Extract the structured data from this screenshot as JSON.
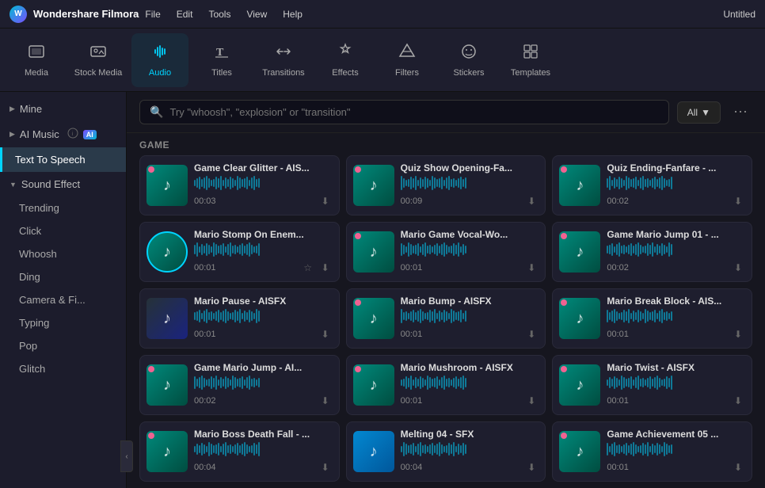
{
  "titleBar": {
    "appName": "Wondershare Filmora",
    "menuItems": [
      "File",
      "Edit",
      "Tools",
      "View",
      "Help"
    ],
    "windowTitle": "Untitled"
  },
  "toolbar": {
    "items": [
      {
        "id": "media",
        "label": "Media",
        "icon": "🎬"
      },
      {
        "id": "stock-media",
        "label": "Stock Media",
        "icon": "📷"
      },
      {
        "id": "audio",
        "label": "Audio",
        "icon": "🎵",
        "active": true
      },
      {
        "id": "titles",
        "label": "Titles",
        "icon": "T"
      },
      {
        "id": "transitions",
        "label": "Transitions",
        "icon": "⇄"
      },
      {
        "id": "effects",
        "label": "Effects",
        "icon": "✦"
      },
      {
        "id": "filters",
        "label": "Filters",
        "icon": "⬡"
      },
      {
        "id": "stickers",
        "label": "Stickers",
        "icon": "😊"
      },
      {
        "id": "templates",
        "label": "Templates",
        "icon": "▦"
      }
    ]
  },
  "sidebar": {
    "mineLabel": "Mine",
    "aiMusicLabel": "AI Music",
    "textToSpeechLabel": "Text To Speech",
    "soundEffectLabel": "Sound Effect",
    "soundEffectItems": [
      {
        "id": "trending",
        "label": "Trending"
      },
      {
        "id": "click",
        "label": "Click"
      },
      {
        "id": "whoosh",
        "label": "Whoosh"
      },
      {
        "id": "ding",
        "label": "Ding"
      },
      {
        "id": "camera",
        "label": "Camera & Fi..."
      },
      {
        "id": "typing",
        "label": "Typing"
      },
      {
        "id": "pop",
        "label": "Pop"
      },
      {
        "id": "glitch",
        "label": "Glitch"
      }
    ]
  },
  "search": {
    "placeholder": "Try \"whoosh\", \"explosion\" or \"transition\"",
    "filterLabel": "All"
  },
  "sectionLabel": "GAME",
  "sounds": [
    [
      {
        "title": "Game Clear Glitter - AIS...",
        "duration": "00:03",
        "favored": true,
        "thumbType": "teal"
      },
      {
        "title": "Quiz Show Opening-Fa...",
        "duration": "00:09",
        "favored": true,
        "thumbType": "teal"
      },
      {
        "title": "Quiz Ending-Fanfare - ...",
        "duration": "00:02",
        "favored": true,
        "thumbType": "teal"
      }
    ],
    [
      {
        "title": "Mario Stomp On Enem...",
        "duration": "00:01",
        "favored": false,
        "thumbType": "spinning",
        "hasMore": true
      },
      {
        "title": "Mario Game Vocal-Wo...",
        "duration": "00:01",
        "favored": true,
        "thumbType": "teal"
      },
      {
        "title": "Game Mario Jump 01 - ...",
        "duration": "00:02",
        "favored": true,
        "thumbType": "teal"
      }
    ],
    [
      {
        "title": "Mario Pause - AISFX",
        "duration": "00:01",
        "favored": false,
        "thumbType": "dark"
      },
      {
        "title": "Mario Bump - AISFX",
        "duration": "00:01",
        "favored": true,
        "thumbType": "teal"
      },
      {
        "title": "Mario Break Block - AIS...",
        "duration": "00:01",
        "favored": true,
        "thumbType": "teal"
      }
    ],
    [
      {
        "title": "Game Mario Jump - AI...",
        "duration": "00:02",
        "favored": true,
        "thumbType": "teal"
      },
      {
        "title": "Mario Mushroom - AISFX",
        "duration": "00:01",
        "favored": true,
        "thumbType": "teal"
      },
      {
        "title": "Mario Twist - AISFX",
        "duration": "00:01",
        "favored": true,
        "thumbType": "teal"
      }
    ],
    [
      {
        "title": "Mario Boss Death Fall - ...",
        "duration": "00:04",
        "favored": true,
        "thumbType": "teal"
      },
      {
        "title": "Melting 04 - SFX",
        "duration": "00:04",
        "favored": false,
        "thumbType": "blue"
      },
      {
        "title": "Game Achievement 05 ...",
        "duration": "00:01",
        "favored": true,
        "thumbType": "teal"
      }
    ]
  ]
}
